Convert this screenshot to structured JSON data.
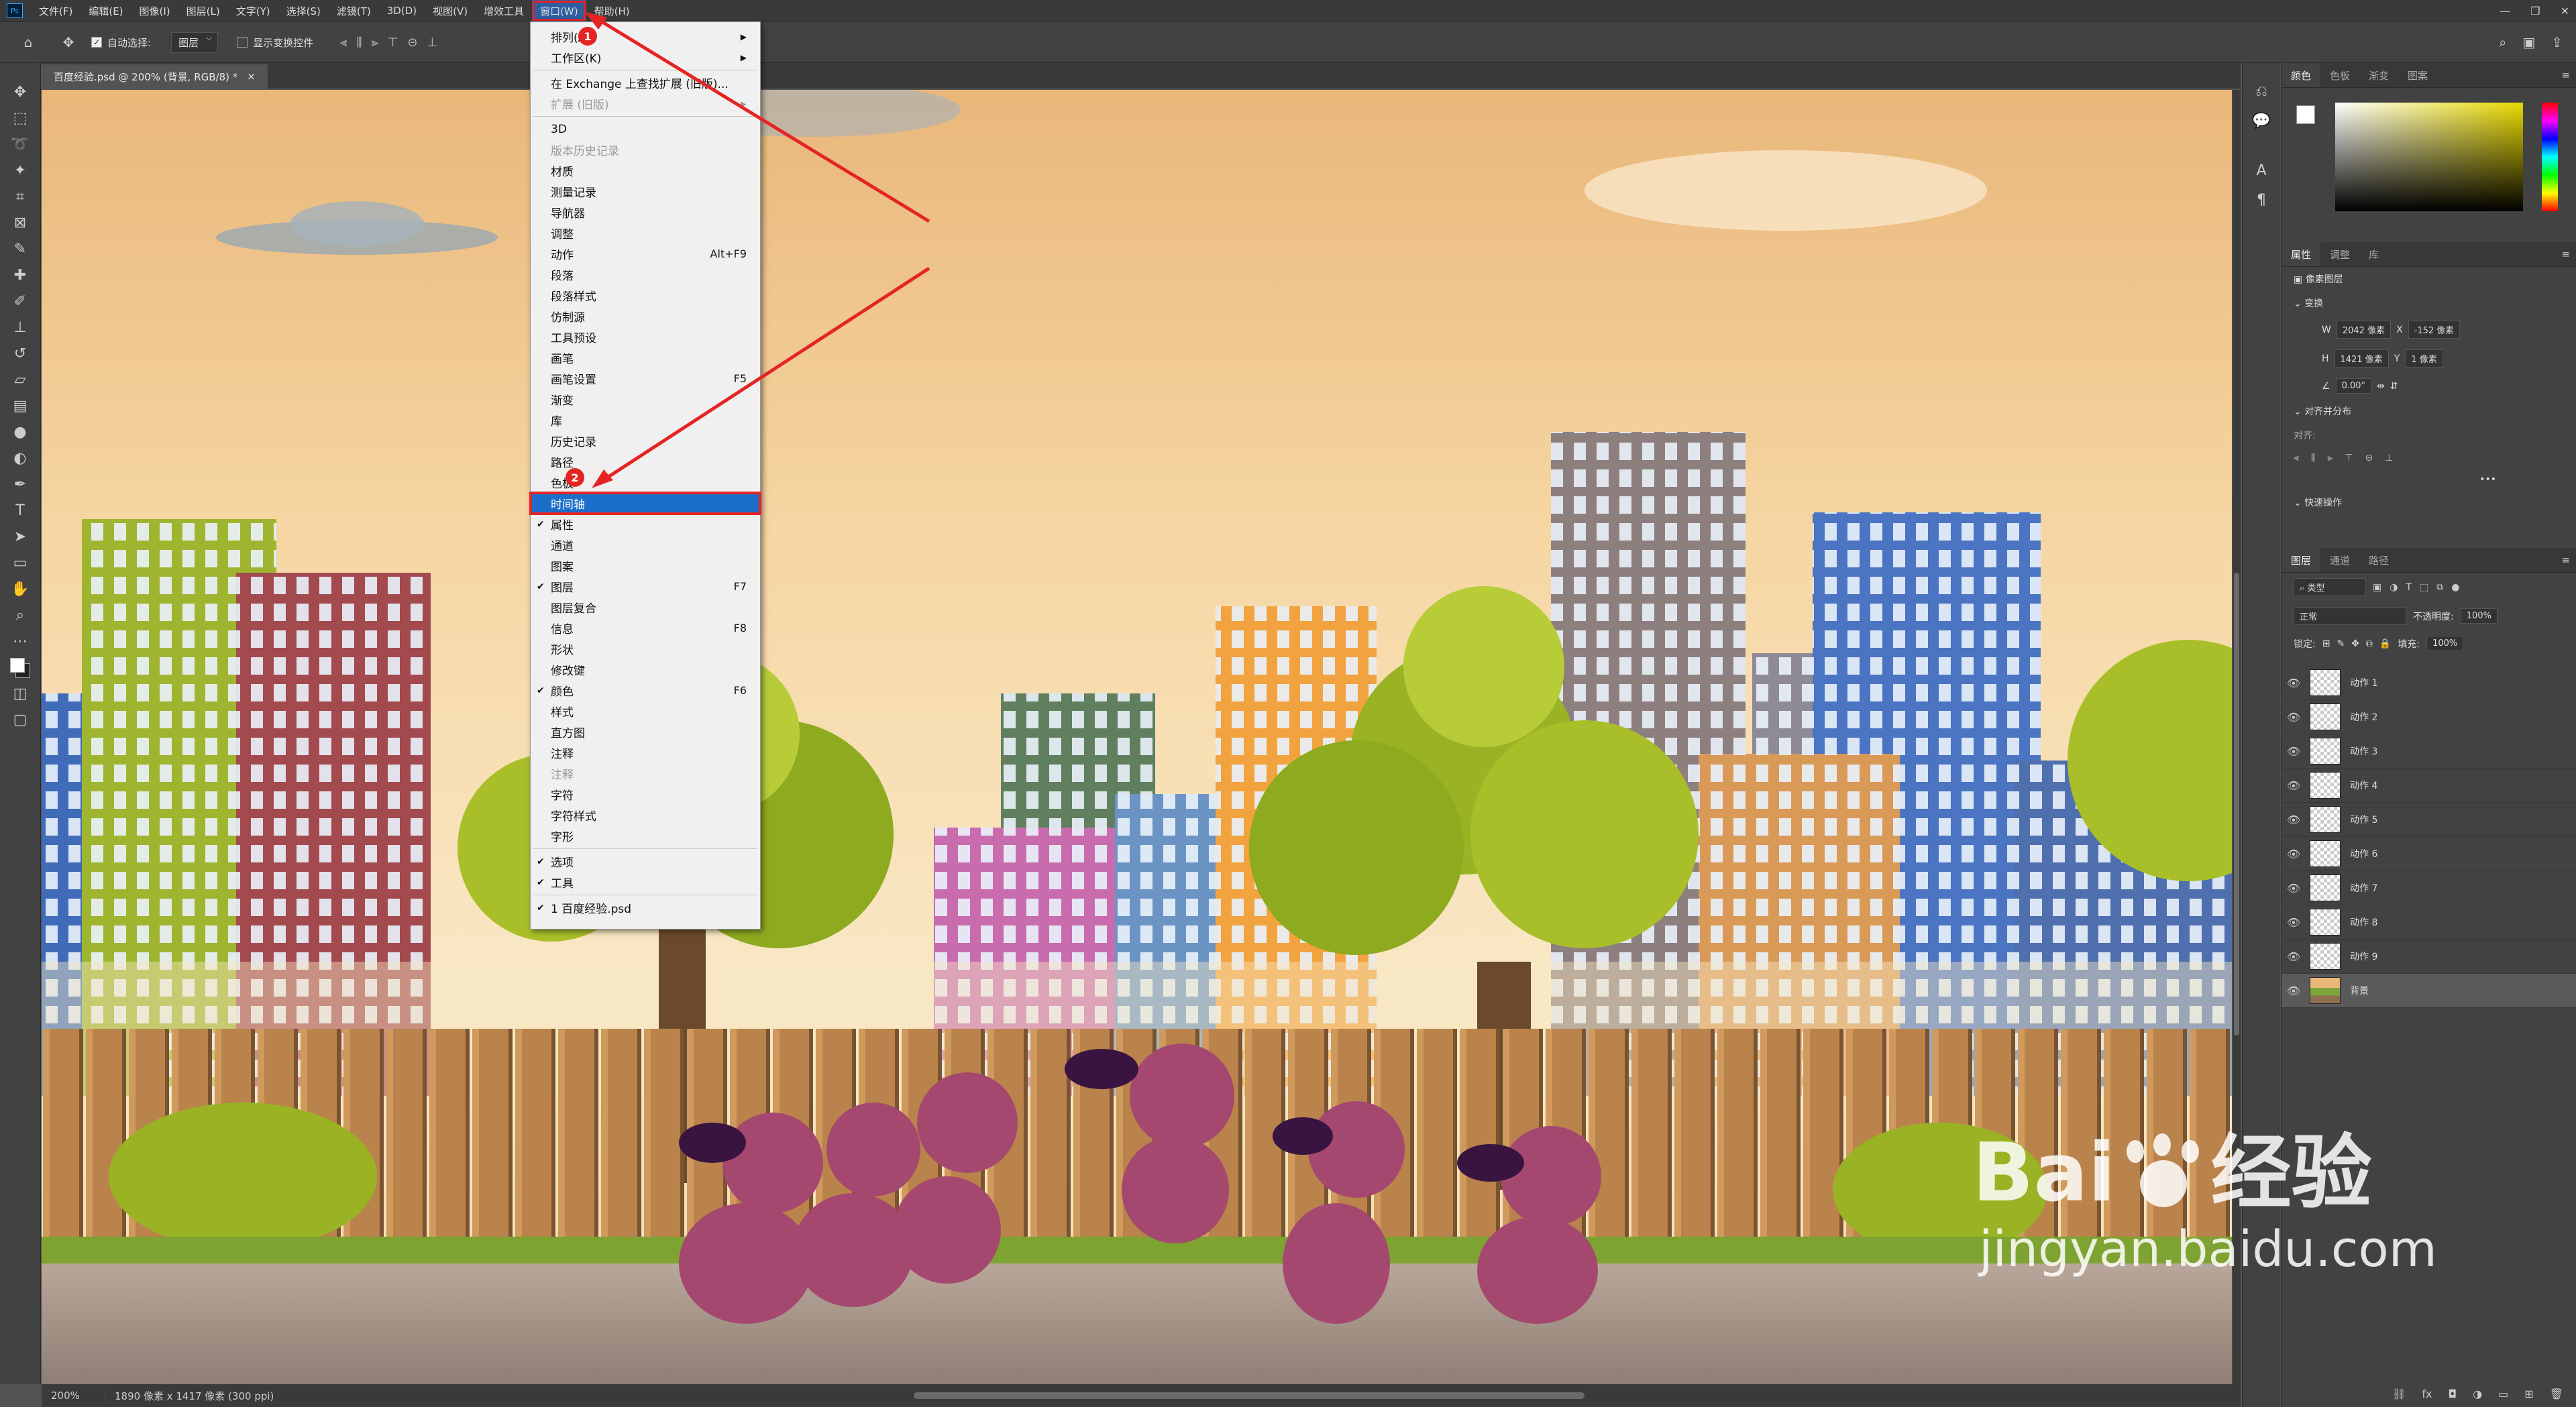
{
  "menubar": {
    "logo": "Ps",
    "items": [
      "文件(F)",
      "编辑(E)",
      "图像(I)",
      "图层(L)",
      "文字(Y)",
      "选择(S)",
      "滤镜(T)",
      "3D(D)",
      "视图(V)",
      "增效工具",
      "窗口(W)",
      "帮助(H)"
    ]
  },
  "options_bar": {
    "auto_select_label": "自动选择:",
    "auto_select_value": "图层",
    "show_transform_label": "显示变换控件"
  },
  "document_tab": {
    "title": "百度经验.psd @ 200% (背景, RGB/8) *",
    "close": "×"
  },
  "window_menu": {
    "items": [
      {
        "label": "排列(A)",
        "check": "",
        "shortcut": "",
        "submenu": true,
        "disabled": false,
        "sep_after": false
      },
      {
        "label": "工作区(K)",
        "check": "",
        "shortcut": "",
        "submenu": true,
        "disabled": false,
        "sep_after": true
      },
      {
        "label": "在 Exchange 上查找扩展 (旧版)...",
        "check": "",
        "shortcut": "",
        "submenu": false,
        "disabled": false,
        "sep_after": false
      },
      {
        "label": "扩展 (旧版)",
        "check": "",
        "shortcut": "",
        "submenu": true,
        "disabled": true,
        "sep_after": true
      },
      {
        "label": "3D",
        "check": "",
        "shortcut": "",
        "submenu": false,
        "disabled": false,
        "sep_after": false
      },
      {
        "label": "版本历史记录",
        "check": "",
        "shortcut": "",
        "submenu": false,
        "disabled": true,
        "sep_after": false
      },
      {
        "label": "材质",
        "check": "",
        "shortcut": "",
        "submenu": false,
        "disabled": false,
        "sep_after": false
      },
      {
        "label": "测量记录",
        "check": "",
        "shortcut": "",
        "submenu": false,
        "disabled": false,
        "sep_after": false
      },
      {
        "label": "导航器",
        "check": "",
        "shortcut": "",
        "submenu": false,
        "disabled": false,
        "sep_after": false
      },
      {
        "label": "调整",
        "check": "",
        "shortcut": "",
        "submenu": false,
        "disabled": false,
        "sep_after": false
      },
      {
        "label": "动作",
        "check": "",
        "shortcut": "Alt+F9",
        "submenu": false,
        "disabled": false,
        "sep_after": false
      },
      {
        "label": "段落",
        "check": "",
        "shortcut": "",
        "submenu": false,
        "disabled": false,
        "sep_after": false
      },
      {
        "label": "段落样式",
        "check": "",
        "shortcut": "",
        "submenu": false,
        "disabled": false,
        "sep_after": false
      },
      {
        "label": "仿制源",
        "check": "",
        "shortcut": "",
        "submenu": false,
        "disabled": false,
        "sep_after": false
      },
      {
        "label": "工具预设",
        "check": "",
        "shortcut": "",
        "submenu": false,
        "disabled": false,
        "sep_after": false
      },
      {
        "label": "画笔",
        "check": "",
        "shortcut": "",
        "submenu": false,
        "disabled": false,
        "sep_after": false
      },
      {
        "label": "画笔设置",
        "check": "",
        "shortcut": "F5",
        "submenu": false,
        "disabled": false,
        "sep_after": false
      },
      {
        "label": "渐变",
        "check": "",
        "shortcut": "",
        "submenu": false,
        "disabled": false,
        "sep_after": false
      },
      {
        "label": "库",
        "check": "",
        "shortcut": "",
        "submenu": false,
        "disabled": false,
        "sep_after": false
      },
      {
        "label": "历史记录",
        "check": "",
        "shortcut": "",
        "submenu": false,
        "disabled": false,
        "sep_after": false
      },
      {
        "label": "路径",
        "check": "",
        "shortcut": "",
        "submenu": false,
        "disabled": false,
        "sep_after": false
      },
      {
        "label": "色板",
        "check": "",
        "shortcut": "",
        "submenu": false,
        "disabled": false,
        "sep_after": false
      },
      {
        "label": "时间轴",
        "check": "",
        "shortcut": "",
        "submenu": false,
        "disabled": false,
        "sep_after": false,
        "highlight": true
      },
      {
        "label": "属性",
        "check": "✔",
        "shortcut": "",
        "submenu": false,
        "disabled": false,
        "sep_after": false
      },
      {
        "label": "通道",
        "check": "",
        "shortcut": "",
        "submenu": false,
        "disabled": false,
        "sep_after": false
      },
      {
        "label": "图案",
        "check": "",
        "shortcut": "",
        "submenu": false,
        "disabled": false,
        "sep_after": false
      },
      {
        "label": "图层",
        "check": "✔",
        "shortcut": "F7",
        "submenu": false,
        "disabled": false,
        "sep_after": false
      },
      {
        "label": "图层复合",
        "check": "",
        "shortcut": "",
        "submenu": false,
        "disabled": false,
        "sep_after": false
      },
      {
        "label": "信息",
        "check": "",
        "shortcut": "F8",
        "submenu": false,
        "disabled": false,
        "sep_after": false
      },
      {
        "label": "形状",
        "check": "",
        "shortcut": "",
        "submenu": false,
        "disabled": false,
        "sep_after": false
      },
      {
        "label": "修改键",
        "check": "",
        "shortcut": "",
        "submenu": false,
        "disabled": false,
        "sep_after": false
      },
      {
        "label": "颜色",
        "check": "✔",
        "shortcut": "F6",
        "submenu": false,
        "disabled": false,
        "sep_after": false
      },
      {
        "label": "样式",
        "check": "",
        "shortcut": "",
        "submenu": false,
        "disabled": false,
        "sep_after": false
      },
      {
        "label": "直方图",
        "check": "",
        "shortcut": "",
        "submenu": false,
        "disabled": false,
        "sep_after": false
      },
      {
        "label": "注释",
        "check": "",
        "shortcut": "",
        "submenu": false,
        "disabled": false,
        "sep_after": false
      },
      {
        "label": "注释",
        "check": "",
        "shortcut": "",
        "submenu": false,
        "disabled": true,
        "sep_after": false
      },
      {
        "label": "字符",
        "check": "",
        "shortcut": "",
        "submenu": false,
        "disabled": false,
        "sep_after": false
      },
      {
        "label": "字符样式",
        "check": "",
        "shortcut": "",
        "submenu": false,
        "disabled": false,
        "sep_after": false
      },
      {
        "label": "字形",
        "check": "",
        "shortcut": "",
        "submenu": false,
        "disabled": false,
        "sep_after": true
      },
      {
        "label": "选项",
        "check": "✔",
        "shortcut": "",
        "submenu": false,
        "disabled": false,
        "sep_after": false
      },
      {
        "label": "工具",
        "check": "✔",
        "shortcut": "",
        "submenu": false,
        "disabled": false,
        "sep_after": true
      },
      {
        "label": "1 百度经验.psd",
        "check": "✔",
        "shortcut": "",
        "submenu": false,
        "disabled": false,
        "sep_after": false
      }
    ]
  },
  "annotations": {
    "badge1": "1",
    "badge2": "2",
    "color": "#e52424"
  },
  "color_panel": {
    "tabs": [
      "颜色",
      "色板",
      "渐变",
      "图案"
    ]
  },
  "properties_panel": {
    "tabs": [
      "属性",
      "调整",
      "库"
    ],
    "layer_type": "像素图层",
    "transform_title": "变换",
    "w_label": "W",
    "w_value": "2042 像素",
    "x_label": "X",
    "x_value": "-152 像素",
    "h_label": "H",
    "h_value": "1421 像素",
    "y_label": "Y",
    "y_value": "1 像素",
    "angle_value": "0.00°",
    "align_title": "对齐并分布",
    "align_label": "对齐:",
    "more": "•••",
    "quick_title": "快速操作"
  },
  "layers_panel": {
    "tabs": [
      "图层",
      "通道",
      "路径"
    ],
    "filter_label": "类型",
    "blend_mode": "正常",
    "opacity_label": "不透明度:",
    "opacity_value": "100%",
    "lock_label": "锁定:",
    "fill_label": "填充:",
    "fill_value": "100%",
    "layers": [
      "动作 1",
      "动作 2",
      "动作 3",
      "动作 4",
      "动作 5",
      "动作 6",
      "动作 7",
      "动作 8",
      "动作 9",
      "背景"
    ]
  },
  "status_bar": {
    "zoom": "200%",
    "dims": "1890 像素 x 1417 像素 (300 ppi)"
  },
  "watermark": {
    "brand": "Bai",
    "brand2": "经验",
    "url": "jingyan.baidu.com"
  }
}
